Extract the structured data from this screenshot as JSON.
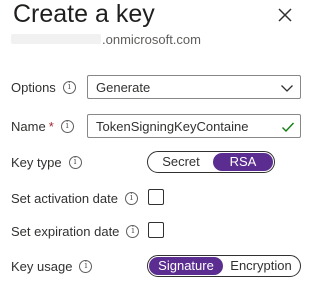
{
  "panel": {
    "title": "Create a key",
    "subtitle": ".onmicrosoft.com"
  },
  "icons": {
    "close": "close-icon",
    "info": "info-icon",
    "dropdown": "chevron-down-icon",
    "valid": "checkmark-icon"
  },
  "colors": {
    "accent": "#5c2d91",
    "required": "#a4262c",
    "valid": "#107c10"
  },
  "form": {
    "options": {
      "label": "Options",
      "value": "Generate"
    },
    "name": {
      "label": "Name",
      "required_mark": "*",
      "value": "TokenSigningKeyContaine"
    },
    "key_type": {
      "label": "Key type",
      "options": [
        "Secret",
        "RSA"
      ],
      "selected": "RSA"
    },
    "activation": {
      "label": "Set activation date",
      "checked": false
    },
    "expiration": {
      "label": "Set expiration date",
      "checked": false
    },
    "key_usage": {
      "label": "Key usage",
      "options": [
        "Signature",
        "Encryption"
      ],
      "selected": "Signature"
    }
  }
}
